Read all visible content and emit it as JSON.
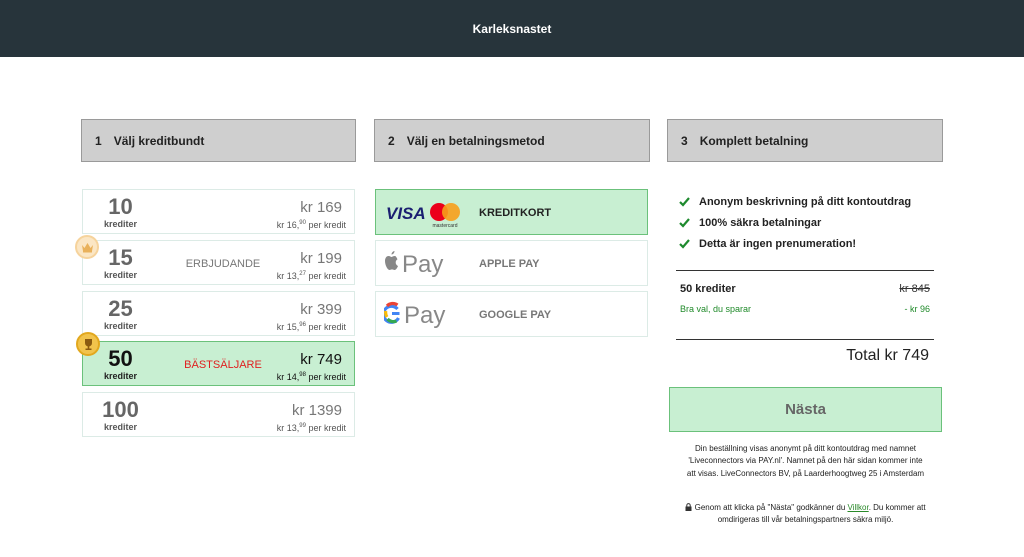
{
  "header": {
    "title": "Karleksnastet"
  },
  "steps": [
    {
      "num": "1",
      "label": "Välj kreditbundt"
    },
    {
      "num": "2",
      "label": "Välj en betalningsmetod"
    },
    {
      "num": "3",
      "label": "Komplett betalning"
    }
  ],
  "packages": [
    {
      "credits": "10",
      "unit": "krediter",
      "tag": "",
      "price": "kr 169",
      "per_prefix": "kr 16,",
      "per_dec": "90",
      "per_suffix": " per kredit"
    },
    {
      "credits": "15",
      "unit": "krediter",
      "tag": "ERBJUDANDE",
      "price": "kr 199",
      "per_prefix": "kr 13,",
      "per_dec": "27",
      "per_suffix": " per kredit"
    },
    {
      "credits": "25",
      "unit": "krediter",
      "tag": "",
      "price": "kr 399",
      "per_prefix": "kr 15,",
      "per_dec": "96",
      "per_suffix": " per kredit"
    },
    {
      "credits": "50",
      "unit": "krediter",
      "tag": "BÄSTSÄLJARE",
      "price": "kr 749",
      "per_prefix": "kr 14,",
      "per_dec": "98",
      "per_suffix": " per kredit"
    },
    {
      "credits": "100",
      "unit": "krediter",
      "tag": "",
      "price": "kr 1399",
      "per_prefix": "kr 13,",
      "per_dec": "99",
      "per_suffix": " per kredit"
    }
  ],
  "payment_methods": [
    {
      "label": "KREDITKORT",
      "logo": "visa-mastercard-logo",
      "logo_text": "VISA",
      "mc_text": "mastercard"
    },
    {
      "label": "APPLE PAY",
      "logo": "apple-pay-logo",
      "logo_text": "Pay"
    },
    {
      "label": "GOOGLE PAY",
      "logo": "google-pay-logo",
      "logo_text": "Pay"
    }
  ],
  "benefits": [
    "Anonym beskrivning på ditt kontoutdrag",
    "100% säkra betalningar",
    "Detta är ingen prenumeration!"
  ],
  "summary": {
    "item": "50 krediter",
    "old_price": "kr 845",
    "saving_label": "Bra val, du sparar",
    "saving_value": "- kr 96",
    "total": "Total kr 749"
  },
  "next_button": "Nästa",
  "info_text": "Din beställning visas anonymt på ditt kontoutdrag med namnet 'Liveconnectors via PAY.nl'. Namnet på den här sidan kommer inte att visas. LiveConnectors BV, på Laarderhoogtweg 25 i Amsterdam",
  "terms": {
    "prefix": "Genom att klicka på \"Nästa\" godkänner du ",
    "link": "Villkor",
    "suffix": ". Du kommer att omdirigeras till vår betalningspartners säkra miljö."
  },
  "colors": {
    "topbar": "#27343b",
    "selected_bg": "#c8efd2",
    "selected_border": "#6bc17b",
    "check": "#1e8a2e",
    "badge_red": "#e02020"
  }
}
